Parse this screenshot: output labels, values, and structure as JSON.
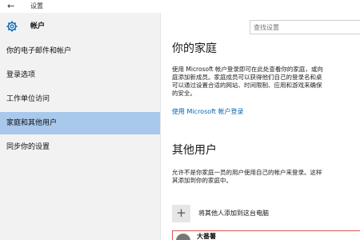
{
  "window": {
    "back_icon": "arrow-left-icon",
    "title": "设置"
  },
  "sidebar": {
    "header_icon": "gear-icon",
    "header_label": "帐户",
    "items": [
      {
        "label": "你的电子邮件和帐户",
        "selected": false
      },
      {
        "label": "登录选项",
        "selected": false
      },
      {
        "label": "工作单位访问",
        "selected": false
      },
      {
        "label": "家庭和其他用户",
        "selected": true
      },
      {
        "label": "同步你的设置",
        "selected": false
      }
    ]
  },
  "search": {
    "placeholder": "查找设置"
  },
  "family": {
    "heading": "你的家庭",
    "desc_lines": [
      "使用 Microsoft 帐户登录即可在此处查看你的家庭，或向",
      "庭添加新成员。家庭成员可以获得他们自己的登录名和桌",
      "可以通过设置合适的网站、时间限制、应用和游戏来确保",
      "的安全。"
    ],
    "link": "使用 Microsoft 帐户登录"
  },
  "other_users": {
    "heading": "其他用户",
    "desc_lines": [
      "允许不是你家庭一员的用户使用自己的帐户来登录。这样",
      "其添加到你的家庭中。"
    ],
    "add_label": "将其他人添加到这台电脑",
    "user_name": "大番薯"
  },
  "colors": {
    "sidebar_bg": "#f2f2f2",
    "selected_bg": "#a8c8ec",
    "link": "#0067b8",
    "highlight_border": "#e05555"
  }
}
